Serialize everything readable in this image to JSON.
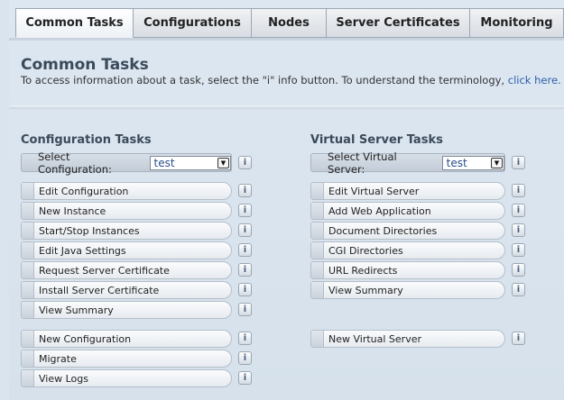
{
  "tabs": [
    {
      "label": "Common Tasks",
      "active": true
    },
    {
      "label": "Configurations",
      "active": false
    },
    {
      "label": "Nodes",
      "active": false
    },
    {
      "label": "Server Certificates",
      "active": false
    },
    {
      "label": "Monitoring",
      "active": false
    }
  ],
  "header": {
    "title": "Common Tasks",
    "description": "To access information about a task, select the \"i\" info button. To understand the terminology,",
    "link": "click here."
  },
  "config_section": {
    "title": "Configuration Tasks",
    "select_label": "Select Configuration:",
    "select_value": "test",
    "tasks_group1": [
      "Edit Configuration",
      "New Instance",
      "Start/Stop Instances",
      "Edit Java Settings",
      "Request Server Certificate",
      "Install Server Certificate",
      "View Summary"
    ],
    "tasks_group2": [
      "New Configuration",
      "Migrate",
      "View Logs"
    ]
  },
  "vs_section": {
    "title": "Virtual Server Tasks",
    "select_label": "Select Virtual Server:",
    "select_value": "test",
    "tasks_group1": [
      "Edit Virtual Server",
      "Add Web Application",
      "Document Directories",
      "CGI Directories",
      "URL Redirects",
      "View Summary"
    ],
    "tasks_group2": [
      "New Virtual Server"
    ]
  },
  "info_icon": "i",
  "colors": {
    "background": "#d9e4ef",
    "title": "#3b4a5a",
    "link": "#2b5fa8",
    "select_value": "#2b4f8f"
  }
}
